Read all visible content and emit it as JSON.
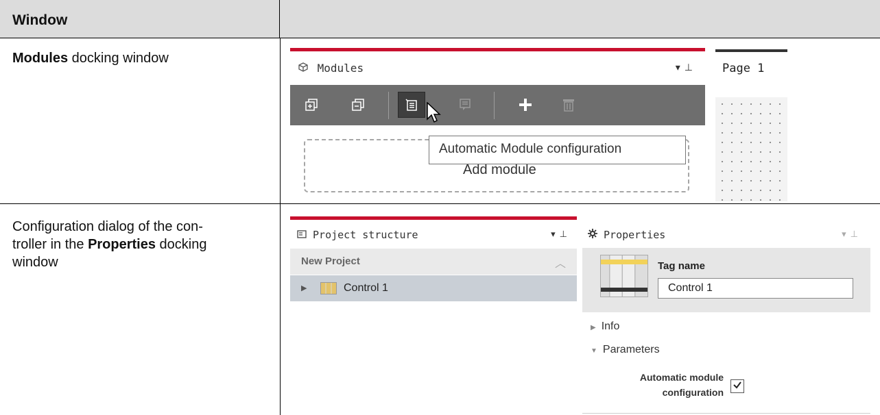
{
  "table": {
    "header_left": "Window",
    "header_right": ""
  },
  "row1": {
    "desc_bold": "Modules",
    "desc_rest": " docking window"
  },
  "row2": {
    "desc_line1": "Configuration dialog of the con-",
    "desc_line2a": "troller in the ",
    "desc_line2b": "Properties",
    "desc_line2c": " docking",
    "desc_line3": "window"
  },
  "modules_panel": {
    "title": "Modules",
    "title_icon": "cube-icon",
    "toolbar": [
      {
        "name": "expand-all",
        "icon": "expand-icon"
      },
      {
        "name": "collapse-all",
        "icon": "collapse-icon"
      },
      {
        "name": "automatic-module-configuration",
        "icon": "auto-config-icon"
      },
      {
        "name": "module-config",
        "icon": "config-icon"
      },
      {
        "name": "add",
        "icon": "plus-icon"
      },
      {
        "name": "delete",
        "icon": "trash-icon"
      }
    ],
    "add_module": "Add module",
    "tooltip": "Automatic Module configuration"
  },
  "page_panel": {
    "title": "Page 1"
  },
  "project_panel": {
    "title": "Project structure",
    "project": "New Project",
    "item": "Control 1"
  },
  "properties_panel": {
    "title": "Properties",
    "tag_label": "Tag name",
    "tag_value": "Control 1",
    "section_info": "Info",
    "section_params": "Parameters",
    "auto_label_1": "Automatic module",
    "auto_label_2": "configuration",
    "auto_checked": true
  },
  "colors": {
    "accent_red": "#c8102e",
    "toolbar_gray": "#6e6e6e",
    "header_gray": "#dcdcdc"
  }
}
